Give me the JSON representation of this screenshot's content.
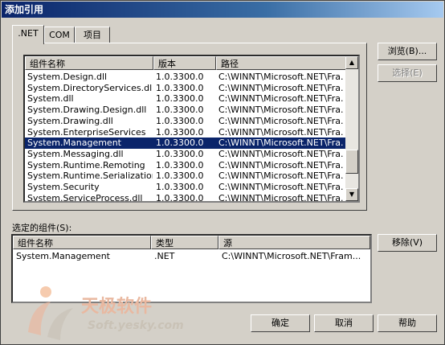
{
  "window": {
    "title": "添加引用"
  },
  "tabs": [
    {
      "label": ".NET"
    },
    {
      "label": "COM"
    },
    {
      "label": "项目"
    }
  ],
  "components": {
    "columns": [
      "组件名称",
      "版本",
      "路径"
    ],
    "rows": [
      [
        "System.Design.dll",
        "1.0.3300.0",
        "C:\\WINNT\\Microsoft.NET\\Fra..."
      ],
      [
        "System.DirectoryServices.dll",
        "1.0.3300.0",
        "C:\\WINNT\\Microsoft.NET\\Fra..."
      ],
      [
        "System.dll",
        "1.0.3300.0",
        "C:\\WINNT\\Microsoft.NET\\Fra..."
      ],
      [
        "System.Drawing.Design.dll",
        "1.0.3300.0",
        "C:\\WINNT\\Microsoft.NET\\Fra..."
      ],
      [
        "System.Drawing.dll",
        "1.0.3300.0",
        "C:\\WINNT\\Microsoft.NET\\Fra..."
      ],
      [
        "System.EnterpriseServices",
        "1.0.3300.0",
        "C:\\WINNT\\Microsoft.NET\\Fra..."
      ],
      [
        "System.Management",
        "1.0.3300.0",
        "C:\\WINNT\\Microsoft.NET\\Fra..."
      ],
      [
        "System.Messaging.dll",
        "1.0.3300.0",
        "C:\\WINNT\\Microsoft.NET\\Fra..."
      ],
      [
        "System.Runtime.Remoting",
        "1.0.3300.0",
        "C:\\WINNT\\Microsoft.NET\\Fra..."
      ],
      [
        "System.Runtime.Serialization....",
        "1.0.3300.0",
        "C:\\WINNT\\Microsoft.NET\\Fra..."
      ],
      [
        "System.Security",
        "1.0.3300.0",
        "C:\\WINNT\\Microsoft.NET\\Fra..."
      ],
      [
        "System.ServiceProcess.dll",
        "1.0.3300.0",
        "C:\\WINNT\\Microsoft.NET\\Fra..."
      ]
    ],
    "selected_index": 6
  },
  "side_buttons": {
    "browse": "浏览(B)...",
    "select": "选择(E)"
  },
  "selected_section": {
    "label": "选定的组件(S):",
    "columns": [
      "组件名称",
      "类型",
      "源"
    ],
    "rows": [
      [
        "System.Management",
        ".NET",
        "C:\\WINNT\\Microsoft.NET\\Fram..."
      ]
    ],
    "remove": "移除(V)"
  },
  "footer": {
    "ok": "确定",
    "cancel": "取消",
    "help": "帮助"
  },
  "watermark": {
    "text": "天极软件",
    "sub": "Soft.yesky.com"
  },
  "colors": {
    "title_start": "#0a246a",
    "selection": "#0a246a",
    "face": "#d4d0c8"
  }
}
